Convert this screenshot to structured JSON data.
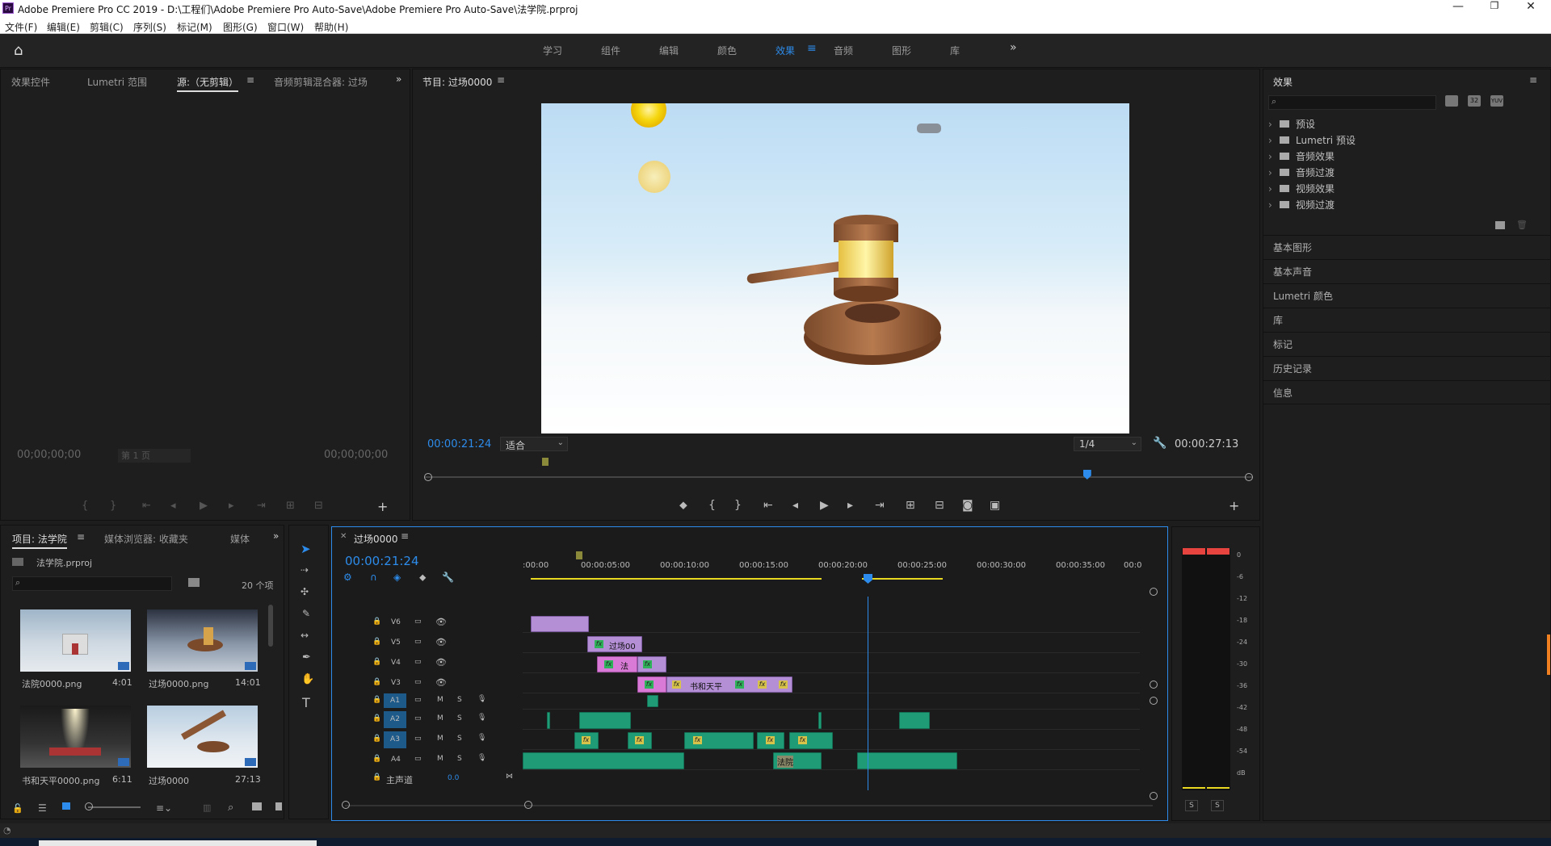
{
  "titlebar": {
    "title": "Adobe Premiere Pro CC 2019 - D:\\工程们\\Adobe Premiere Pro Auto-Save\\Adobe Premiere Pro Auto-Save\\法学院.prproj",
    "app_badge": "Pr"
  },
  "menu": [
    "文件(F)",
    "编辑(E)",
    "剪辑(C)",
    "序列(S)",
    "标记(M)",
    "图形(G)",
    "窗口(W)",
    "帮助(H)"
  ],
  "workspaces": [
    "学习",
    "组件",
    "编辑",
    "颜色",
    "效果",
    "音频",
    "图形",
    "库"
  ],
  "active_workspace": "效果",
  "source_panel": {
    "tabs": [
      "效果控件",
      "Lumetri 范围",
      "源:（无剪辑）",
      "音频剪辑混合器: 过场"
    ],
    "active_tab": "源:（无剪辑）",
    "timecode_left": "00;00;00;00",
    "page": "第 1 页",
    "timecode_right": "00;00;00;00"
  },
  "program_panel": {
    "title": "节目: 过场0000",
    "timecode": "00:00:21:24",
    "fit": "适合",
    "quality": "1/4",
    "duration": "00:00:27:13",
    "playhead_progress": 0.8
  },
  "project_panel": {
    "tabs": [
      "项目: 法学院",
      "媒体浏览器: 收藏夹",
      "媒体"
    ],
    "project_file": "法学院.prproj",
    "item_count": "20 个项",
    "items": [
      {
        "name": "法院0000.png",
        "duration": "4:01"
      },
      {
        "name": "过场0000.png",
        "duration": "14:01"
      },
      {
        "name": "书和天平0000.png",
        "duration": "6:11"
      },
      {
        "name": "过场0000",
        "duration": "27:13"
      }
    ]
  },
  "timeline": {
    "sequence_name": "过场0000",
    "timecode": "00:00:21:24",
    "ruler": [
      ":00:00",
      "00:00:05:00",
      "00:00:10:00",
      "00:00:15:00",
      "00:00:20:00",
      "00:00:25:00",
      "00:00:30:00",
      "00:00:35:00",
      "00:0"
    ],
    "video_tracks": [
      "V6",
      "V5",
      "V4",
      "V3"
    ],
    "audio_tracks": [
      "A1",
      "A2",
      "A3",
      "A4"
    ],
    "master_label": "主声道",
    "master_value": "0.0",
    "clip_labels": {
      "v5": "过场00",
      "v4": "法",
      "v3": "书和天平",
      "a4": "法院"
    },
    "audio_buttons": {
      "mute": "M",
      "solo": "S"
    }
  },
  "effects_panel": {
    "title": "效果",
    "folders": [
      "预设",
      "Lumetri 预设",
      "音频效果",
      "音频过渡",
      "视频效果",
      "视频过渡"
    ],
    "sections": [
      "基本图形",
      "基本声音",
      "Lumetri 颜色",
      "库",
      "标记",
      "历史记录",
      "信息"
    ],
    "filter_labels": [
      "32",
      "YUV"
    ]
  },
  "meter": {
    "scale": [
      "0",
      "-6",
      "-12",
      "-18",
      "-24",
      "-30",
      "-36",
      "-42",
      "-48",
      "-54",
      "dB"
    ],
    "solo": [
      "S",
      "S"
    ]
  },
  "colors": {
    "accent": "#2d8ceb",
    "clip_video": "#b48fd6",
    "clip_pink": "#d97ad6",
    "clip_audio": "#1f9b75",
    "fx_badge": "#d7c24a"
  },
  "window_controls": [
    "minimize",
    "maximize",
    "close"
  ]
}
